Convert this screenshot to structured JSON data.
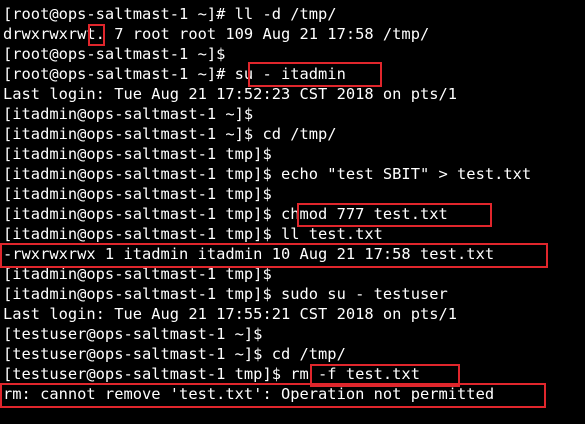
{
  "terminal": {
    "lines": [
      "[root@ops-saltmast-1 ~]# ll -d /tmp/",
      "drwxrwxrwt. 7 root root 109 Aug 21 17:58 /tmp/",
      "[root@ops-saltmast-1 ~]$",
      "[root@ops-saltmast-1 ~]# su - itadmin",
      "Last login: Tue Aug 21 17:52:23 CST 2018 on pts/1",
      "[itadmin@ops-saltmast-1 ~]$",
      "[itadmin@ops-saltmast-1 ~]$ cd /tmp/",
      "[itadmin@ops-saltmast-1 tmp]$",
      "[itadmin@ops-saltmast-1 tmp]$ echo \"test SBIT\" > test.txt",
      "[itadmin@ops-saltmast-1 tmp]$",
      "[itadmin@ops-saltmast-1 tmp]$ chmod 777 test.txt",
      "[itadmin@ops-saltmast-1 tmp]$ ll test.txt",
      "-rwxrwxrwx 1 itadmin itadmin 10 Aug 21 17:58 test.txt",
      "[itadmin@ops-saltmast-1 tmp]$",
      "[itadmin@ops-saltmast-1 tmp]$ sudo su - testuser",
      "Last login: Tue Aug 21 17:55:21 CST 2018 on pts/1",
      "[testuser@ops-saltmast-1 ~]$",
      "[testuser@ops-saltmast-1 ~]$ cd /tmp/",
      "[testuser@ops-saltmast-1 tmp]$ rm -f test.txt",
      "rm: cannot remove 'test.txt': Operation not permitted"
    ]
  },
  "colors": {
    "background": "#000000",
    "text": "#ffffff",
    "highlight_box": "#e0262c"
  }
}
